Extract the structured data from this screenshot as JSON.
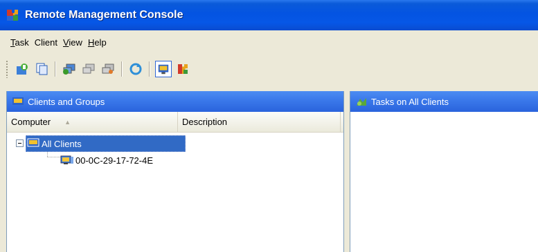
{
  "window": {
    "title": "Remote Management Console",
    "icon": "puzzle-icon"
  },
  "menu": {
    "items": [
      {
        "label_first": "T",
        "label_rest": "ask"
      },
      {
        "label_first": "",
        "label_rest": "Client"
      },
      {
        "label_first": "V",
        "label_rest": "iew"
      },
      {
        "label_first": "H",
        "label_rest": "elp"
      }
    ]
  },
  "toolbar": {
    "buttons": [
      "add-group-icon",
      "copy-icon",
      "add-client-icon",
      "remove-client-icon",
      "client-properties-icon",
      "refresh-icon",
      "clients-view-icon",
      "tasks-view-icon"
    ]
  },
  "clients_pane": {
    "title": "Clients and Groups",
    "columns": [
      "Computer",
      "Description"
    ],
    "tree": {
      "root": {
        "label": "All Clients"
      },
      "children": [
        {
          "label": "00-0C-29-17-72-4E"
        }
      ]
    }
  },
  "tasks_pane": {
    "title": "Tasks on All Clients"
  },
  "colors": {
    "title_bar": "#0454e2",
    "pane_header": "#3a78ea",
    "selection": "#316ac5",
    "background": "#ece9d8"
  }
}
